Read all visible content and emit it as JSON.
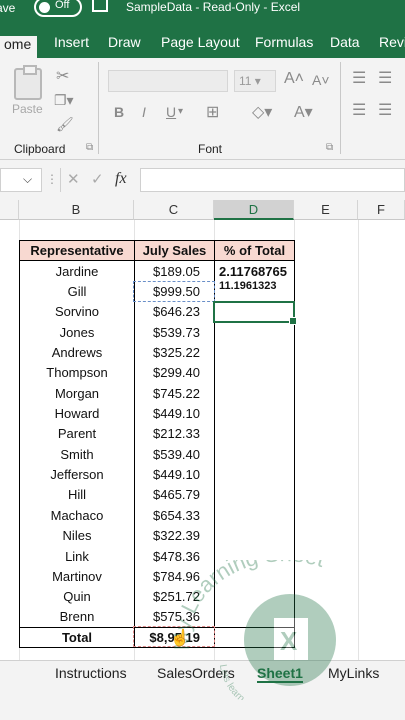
{
  "title_bar": {
    "autosave_label": "ave",
    "autosave_state": "Off",
    "file_name": "SampleData - Read-Only - Excel"
  },
  "ribbon_tabs": [
    "ome",
    "Insert",
    "Draw",
    "Page Layout",
    "Formulas",
    "Data",
    "Revi"
  ],
  "ribbon": {
    "paste_label": "Paste",
    "clipboard_label": "Clipboard",
    "font_label": "Font",
    "font_size": "11",
    "bold": "B",
    "italic": "I",
    "underline": "U"
  },
  "formula_bar": {
    "fx": "fx",
    "cancel": "✕",
    "enter": "✓",
    "content": ""
  },
  "columns": [
    "B",
    "C",
    "D",
    "E",
    "F"
  ],
  "table": {
    "headers": [
      "Representative",
      "July Sales",
      "% of Total"
    ],
    "rows": [
      {
        "rep": "Jardine",
        "sales": "$189.05",
        "pct": "2.11768765"
      },
      {
        "rep": "Gill",
        "sales": "$999.50",
        "pct": "11.1961323"
      },
      {
        "rep": "Sorvino",
        "sales": "$646.23",
        "pct": ""
      },
      {
        "rep": "Jones",
        "sales": "$539.73",
        "pct": ""
      },
      {
        "rep": "Andrews",
        "sales": "$325.22",
        "pct": ""
      },
      {
        "rep": "Thompson",
        "sales": "$299.40",
        "pct": ""
      },
      {
        "rep": "Morgan",
        "sales": "$745.22",
        "pct": ""
      },
      {
        "rep": "Howard",
        "sales": "$449.10",
        "pct": ""
      },
      {
        "rep": "Parent",
        "sales": "$212.33",
        "pct": ""
      },
      {
        "rep": "Smith",
        "sales": "$539.40",
        "pct": ""
      },
      {
        "rep": "Jefferson",
        "sales": "$449.10",
        "pct": ""
      },
      {
        "rep": "Hill",
        "sales": "$465.79",
        "pct": ""
      },
      {
        "rep": "Machaco",
        "sales": "$654.33",
        "pct": ""
      },
      {
        "rep": "Niles",
        "sales": "$322.39",
        "pct": ""
      },
      {
        "rep": "Link",
        "sales": "$478.36",
        "pct": ""
      },
      {
        "rep": "Martinov",
        "sales": "$784.96",
        "pct": ""
      },
      {
        "rep": "Quin",
        "sales": "$251.72",
        "pct": ""
      },
      {
        "rep": "Brenn",
        "sales": "$575.36",
        "pct": ""
      }
    ],
    "total_label": "Total",
    "total_value": "$8,9​‌5.19"
  },
  "sheet_tabs": [
    "Instructions",
    "SalesOrders",
    "Sheet1",
    "MyLinks"
  ],
  "active_sheet": "Sheet1",
  "watermark": {
    "text": "My Learning Sheet",
    "tagline": "Lets learn something"
  },
  "colors": {
    "excel_green": "#1f7245",
    "header_fill": "#f8d9d1"
  }
}
